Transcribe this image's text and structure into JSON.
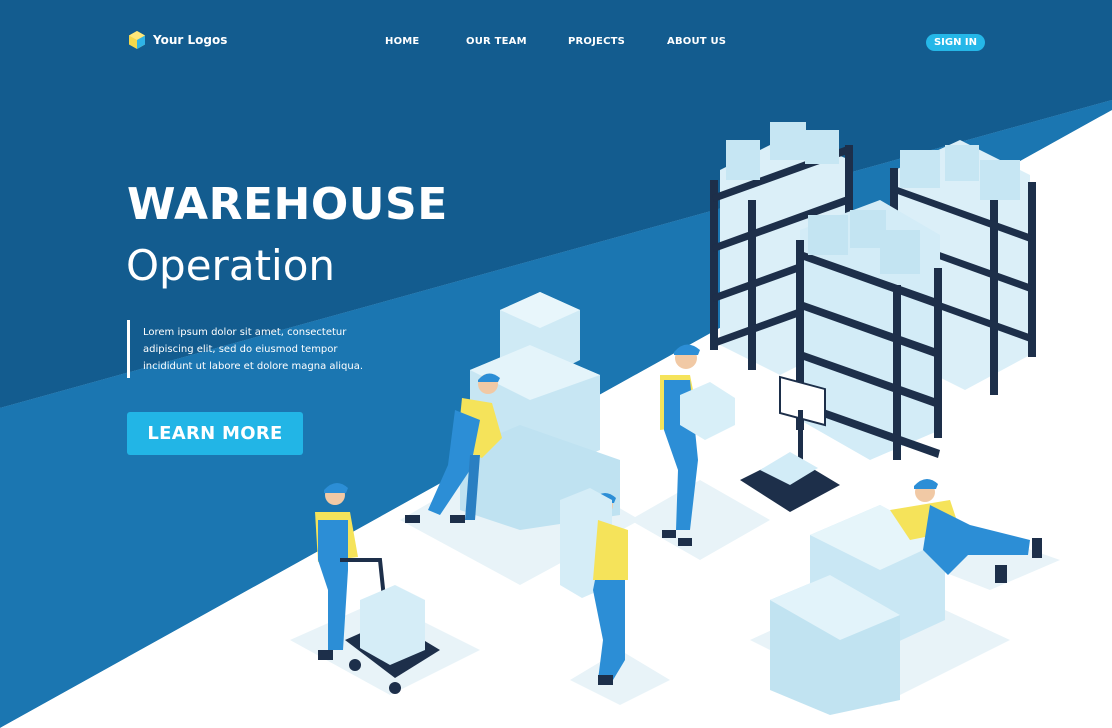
{
  "brand": {
    "logo_text": "Your Logos",
    "icon": "hexagon-logo-icon"
  },
  "nav": {
    "items": [
      {
        "label": "HOME"
      },
      {
        "label": "OUR TEAM"
      },
      {
        "label": "PROJECTS"
      },
      {
        "label": "ABOUT US"
      }
    ],
    "sign_in": "SIGN IN"
  },
  "hero": {
    "title": "WAREHOUSE",
    "subtitle": "Operation",
    "description": "Lorem ipsum dolor sit amet, consectetur adipiscing elit, sed do eiusmod tempor incididunt ut labore et dolore magna aliqua.",
    "cta": "LEARN MORE"
  },
  "colors": {
    "dark_blue": "#0f5a8c",
    "mid_blue": "#1b75b0",
    "accent": "#25b7e8",
    "worker_yellow": "#f5e35a",
    "worker_blue": "#2c8ed6",
    "box": "#d6eef7"
  }
}
